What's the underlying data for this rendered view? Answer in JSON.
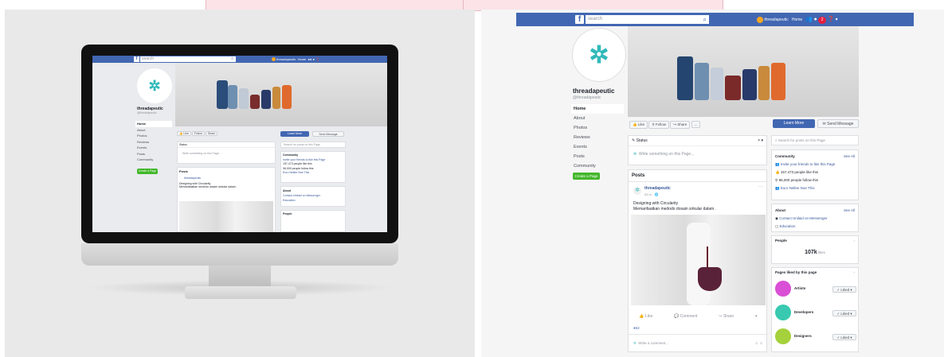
{
  "search": {
    "placeholder": "search"
  },
  "topbar": {
    "profile_name": "threadapeutic",
    "home_label": "Home",
    "notif_count": "2"
  },
  "page": {
    "name": "threadapeutic",
    "handle": "@threadapeutic"
  },
  "nav": {
    "items": [
      "Home",
      "About",
      "Photos",
      "Reviews",
      "Events",
      "Posts",
      "Community"
    ],
    "create_page": "Create a Page"
  },
  "actions": {
    "like": "Like",
    "follow": "Follow",
    "share": "Share",
    "more": "...",
    "learn_more": "Learn More",
    "send_message": "Send Message"
  },
  "status": {
    "label": "Status",
    "placeholder": "Write something on this Page..."
  },
  "posts": {
    "heading": "Posts",
    "author": "threadapeutic",
    "time": "53 m",
    "line1": "Designing with Circularity",
    "line2": "Memanfaatkan medodo dosain sirkular dalam .",
    "like": "Like",
    "comment": "Comment",
    "share": "Share",
    "reactions": "52",
    "comment_placeholder": "Write a comment..."
  },
  "right": {
    "search_placeholder": "Search for posts on this Page",
    "community": {
      "title": "Community",
      "see_all": "See All",
      "invite": "Invite your friends to like this Page",
      "likes": "157,473 people like this",
      "follows": "96,000 people follow this",
      "visits": "Euro Nellee Noe This"
    },
    "about": {
      "title": "About",
      "see_all": "See All",
      "contact": "Contact Unilaid on Messenger",
      "category": "Education"
    },
    "people": {
      "title": "People",
      "count": "107k",
      "suffix": "likes"
    },
    "pages_liked": {
      "title": "Pages liked by this page",
      "items": [
        {
          "name": "Artists",
          "color": "#d94fd5",
          "btn": "Liked"
        },
        {
          "name": "Developers",
          "color": "#38c9b0",
          "btn": "Liked"
        },
        {
          "name": "Designers",
          "color": "#a5d13c",
          "btn": "Liked"
        }
      ]
    }
  },
  "colors": {
    "brand": "#4267b2",
    "green": "#42b72a",
    "teal": "#31b9b9"
  }
}
